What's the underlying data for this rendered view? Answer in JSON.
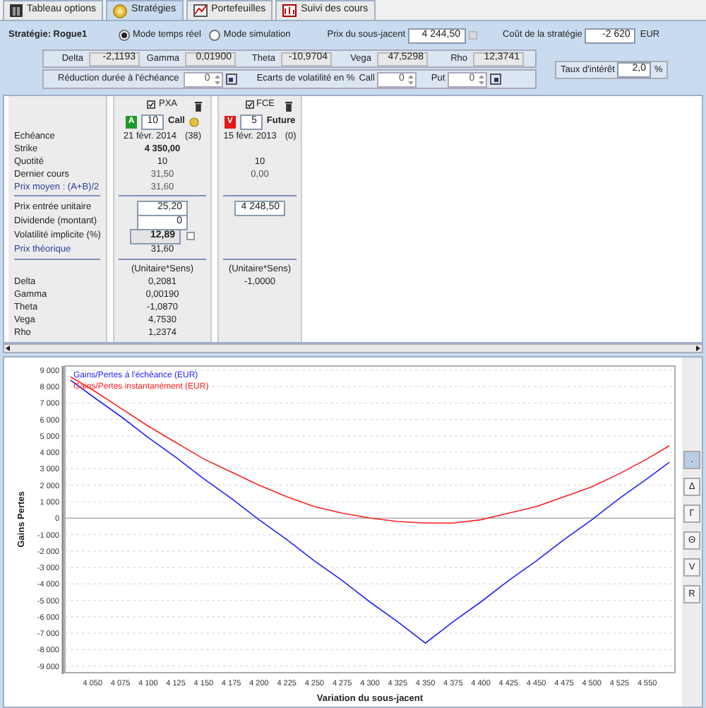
{
  "tabs": [
    {
      "label": "Tableau options",
      "selected": false
    },
    {
      "label": "Stratégies",
      "selected": true
    },
    {
      "label": "Portefeuilles",
      "selected": false
    },
    {
      "label": "Suivi des cours",
      "selected": false
    }
  ],
  "header": {
    "strategy": "Stratégie: Rogue1",
    "modes": [
      {
        "label": "Mode temps réel",
        "selected": true
      },
      {
        "label": "Mode simulation",
        "selected": false
      }
    ],
    "underlying": {
      "label": "Prix du sous-jacent",
      "value": "4 244,50"
    },
    "cost": {
      "label": "Coût de la stratégie",
      "value": "-2 620",
      "unit": "EUR"
    },
    "greeks": [
      {
        "label": "Delta",
        "value": "-2,1193"
      },
      {
        "label": "Gamma",
        "value": "0,01900"
      },
      {
        "label": "Theta",
        "value": "-10,9704"
      },
      {
        "label": "Vega",
        "value": "47,5298"
      },
      {
        "label": "Rho",
        "value": "12,3741"
      }
    ],
    "reduction": {
      "label": "Réduction durée à l'échéance",
      "value": "0"
    },
    "volatility": {
      "label": "Ecarts de volatilité en %",
      "call_label": "Call",
      "call_value": "0",
      "put_label": "Put",
      "put_value": "0"
    },
    "interest": {
      "label": "Taux d'intérêt",
      "value": "2,0",
      "unit": "%"
    }
  },
  "legs_panel": {
    "market_labels": [
      {
        "text": "Echéance",
        "accent": false
      },
      {
        "text": "Strike",
        "accent": false
      },
      {
        "text": "Quotité",
        "accent": false
      },
      {
        "text": "Dernier cours",
        "accent": false
      },
      {
        "text": "Prix moyen : (A+B)/2",
        "accent": true
      }
    ],
    "input_labels": [
      {
        "text": "Prix entrée unitaire",
        "accent": false
      },
      {
        "text": "Dividende (montant)",
        "accent": false
      },
      {
        "text": "Volatilité implicite (%)",
        "accent": false
      },
      {
        "text": "Prix théorique",
        "accent": true
      }
    ],
    "greek_labels": [
      "Delta",
      "Gamma",
      "Theta",
      "Vega",
      "Rho"
    ],
    "legs": [
      {
        "checked": true,
        "name": "PXA",
        "side": "A",
        "color": "#1f9a2a",
        "quantity": "10",
        "type": "Call",
        "calculator": true,
        "expiry": "21 févr. 2014",
        "days": "(38)",
        "strike": "4 350,00",
        "quotity": "10",
        "last_price": "31,50",
        "mid_price": "31,60",
        "entry_price": "25,20",
        "dividend": "0",
        "implied_vol": "12,89",
        "vol_locked": false,
        "theoretical_price": "31,60",
        "greeks_header": "(Unitaire*Sens)",
        "greeks": [
          "0,2081",
          "0,00190",
          "-1,0870",
          "4,7530",
          "1,2374"
        ]
      },
      {
        "checked": true,
        "name": "FCE",
        "side": "V",
        "color": "#e01818",
        "quantity": "5",
        "type": "Future",
        "calculator": false,
        "expiry": "15 févr. 2013",
        "days": "(0)",
        "quotity": "10",
        "last_price": "0,00",
        "entry_price": "4 248,50",
        "greeks_header": "(Unitaire*Sens)",
        "greeks": [
          "-1,0000"
        ]
      }
    ]
  },
  "chart": {
    "chart_data": {
      "type": "line",
      "xlabel": "Variation du sous-jacent",
      "ylabel": "Gains Pertes",
      "x": [
        4030,
        4050,
        4075,
        4100,
        4125,
        4150,
        4175,
        4200,
        4225,
        4250,
        4275,
        4300,
        4325,
        4350,
        4375,
        4400,
        4425,
        4450,
        4475,
        4500,
        4525,
        4550,
        4570
      ],
      "series": [
        {
          "name": "Gains/Pertes à l'échéance (EUR)",
          "color": "#2020ff",
          "values": [
            8400,
            7400,
            6200,
            4900,
            3700,
            2400,
            1200,
            -100,
            -1300,
            -2600,
            -3800,
            -5100,
            -6300,
            -7600,
            -6300,
            -5100,
            -3800,
            -2600,
            -1300,
            -100,
            1200,
            2400,
            3400
          ]
        },
        {
          "name": "Gains/Pertes instantanément (EUR)",
          "color": "#ff2020",
          "values": [
            8600,
            7800,
            6700,
            5600,
            4600,
            3600,
            2800,
            2000,
            1300,
            700,
            300,
            0,
            -200,
            -300,
            -300,
            -100,
            300,
            700,
            1300,
            1900,
            2700,
            3600,
            4400
          ]
        }
      ],
      "grid": true,
      "xlim": [
        4025,
        4575
      ],
      "ylim": [
        -9400,
        9250
      ],
      "xticks": [
        {
          "value": 4050,
          "label": "4 050"
        },
        {
          "value": 4075,
          "label": "4 075"
        },
        {
          "value": 4100,
          "label": "4 100"
        },
        {
          "value": 4125,
          "label": "4 125"
        },
        {
          "value": 4150,
          "label": "4 150"
        },
        {
          "value": 4175,
          "label": "4 175"
        },
        {
          "value": 4200,
          "label": "4 200"
        },
        {
          "value": 4225,
          "label": "4 225"
        },
        {
          "value": 4250,
          "label": "4 250"
        },
        {
          "value": 4275,
          "label": "4 275"
        },
        {
          "value": 4300,
          "label": "4 300"
        },
        {
          "value": 4325,
          "label": "4 325"
        },
        {
          "value": 4350,
          "label": "4 350"
        },
        {
          "value": 4375,
          "label": "4 375"
        },
        {
          "value": 4400,
          "label": "4 400"
        },
        {
          "value": 4425,
          "label": "4 425"
        },
        {
          "value": 4450,
          "label": "4 450"
        },
        {
          "value": 4475,
          "label": "4 475"
        },
        {
          "value": 4500,
          "label": "4 500"
        },
        {
          "value": 4525,
          "label": "4 525"
        },
        {
          "value": 4550,
          "label": "4 550"
        }
      ],
      "yticks": [
        {
          "value": 9000,
          "label": "9 000"
        },
        {
          "value": 8000,
          "label": "8 000"
        },
        {
          "value": 7000,
          "label": "7 000"
        },
        {
          "value": 6000,
          "label": "6 000"
        },
        {
          "value": 5000,
          "label": "5 000"
        },
        {
          "value": 4000,
          "label": "4 000"
        },
        {
          "value": 3000,
          "label": "3 000"
        },
        {
          "value": 2000,
          "label": "2 000"
        },
        {
          "value": 1000,
          "label": "1 000"
        },
        {
          "value": 0,
          "label": "0"
        },
        {
          "value": -1000,
          "label": "-1 000"
        },
        {
          "value": -2000,
          "label": "-2 000"
        },
        {
          "value": -3000,
          "label": "-3 000"
        },
        {
          "value": -4000,
          "label": "-4 000"
        },
        {
          "value": -5000,
          "label": "-5 000"
        },
        {
          "value": -6000,
          "label": "-6 000"
        },
        {
          "value": -7000,
          "label": "-7 000"
        },
        {
          "value": -8000,
          "label": "-8 000"
        },
        {
          "value": -9000,
          "label": "-9 000"
        }
      ]
    },
    "view_buttons": [
      {
        "label": ".",
        "selected": true
      },
      {
        "label": "Δ",
        "selected": false
      },
      {
        "label": "Γ",
        "selected": false
      },
      {
        "label": "Θ",
        "selected": false
      },
      {
        "label": "V",
        "selected": false
      },
      {
        "label": "R",
        "selected": false
      }
    ]
  }
}
